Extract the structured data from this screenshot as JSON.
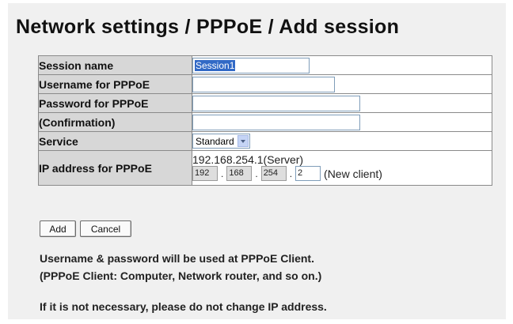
{
  "title": "Network settings / PPPoE / Add session",
  "form": {
    "rows": {
      "session_name": {
        "label": "Session name",
        "value": "Session1"
      },
      "username": {
        "label": "Username for PPPoE",
        "value": ""
      },
      "password": {
        "label": "Password for PPPoE",
        "value": ""
      },
      "confirmation": {
        "label": "(Confirmation)",
        "value": ""
      },
      "service": {
        "label": "Service",
        "value": "Standard"
      },
      "ip": {
        "label": "IP address for PPPoE",
        "server": "192.168.254.1(Server)",
        "octets": [
          "192",
          "168",
          "254",
          "2"
        ],
        "separator": ".",
        "client_note": "(New client)"
      }
    }
  },
  "buttons": {
    "add": "Add",
    "cancel": "Cancel"
  },
  "notes": {
    "line1": "Username & password will be used at PPPoE Client.",
    "line2": "(PPPoE Client: Computer, Network router, and so on.)",
    "line3": "If it is not necessary, please do not change IP address."
  }
}
